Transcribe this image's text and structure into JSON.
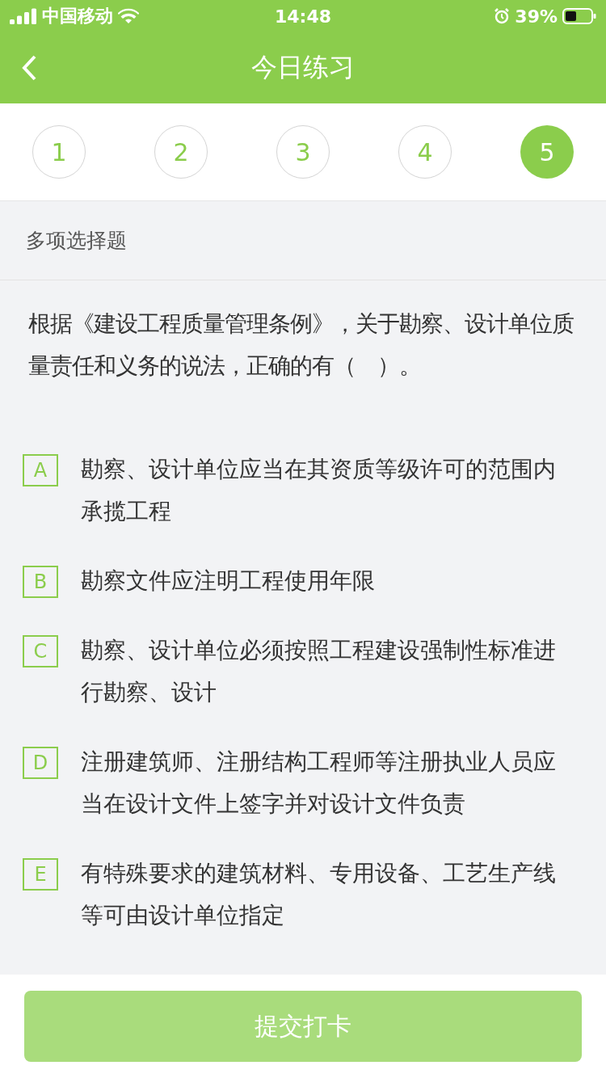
{
  "status_bar": {
    "carrier": "中国移动",
    "time": "14:48",
    "battery": "39%"
  },
  "nav": {
    "title": "今日练习"
  },
  "steps": [
    {
      "label": "1",
      "selected": false
    },
    {
      "label": "2",
      "selected": false
    },
    {
      "label": "3",
      "selected": false
    },
    {
      "label": "4",
      "selected": false
    },
    {
      "label": "5",
      "selected": true
    }
  ],
  "question": {
    "type": "多项选择题",
    "text": "根据《建设工程质量管理条例》，关于勘察、设计单位质量责任和义务的说法，正确的有（　）。",
    "options": [
      {
        "letter": "A",
        "text": "勘察、设计单位应当在其资质等级许可的范围内承揽工程",
        "selected": false
      },
      {
        "letter": "B",
        "text": "勘察文件应注明工程使用年限",
        "selected": false
      },
      {
        "letter": "C",
        "text": "勘察、设计单位必须按照工程建设强制性标准进行勘察、设计",
        "selected": false
      },
      {
        "letter": "D",
        "text": "注册建筑师、注册结构工程师等注册执业人员应当在设计文件上签字并对设计文件负责",
        "selected": false
      },
      {
        "letter": "E",
        "text": "有特殊要求的建筑材料、专用设备、工艺生产线等可由设计单位指定",
        "selected": false
      }
    ]
  },
  "submit": {
    "label": "提交打卡",
    "disabled": true
  }
}
